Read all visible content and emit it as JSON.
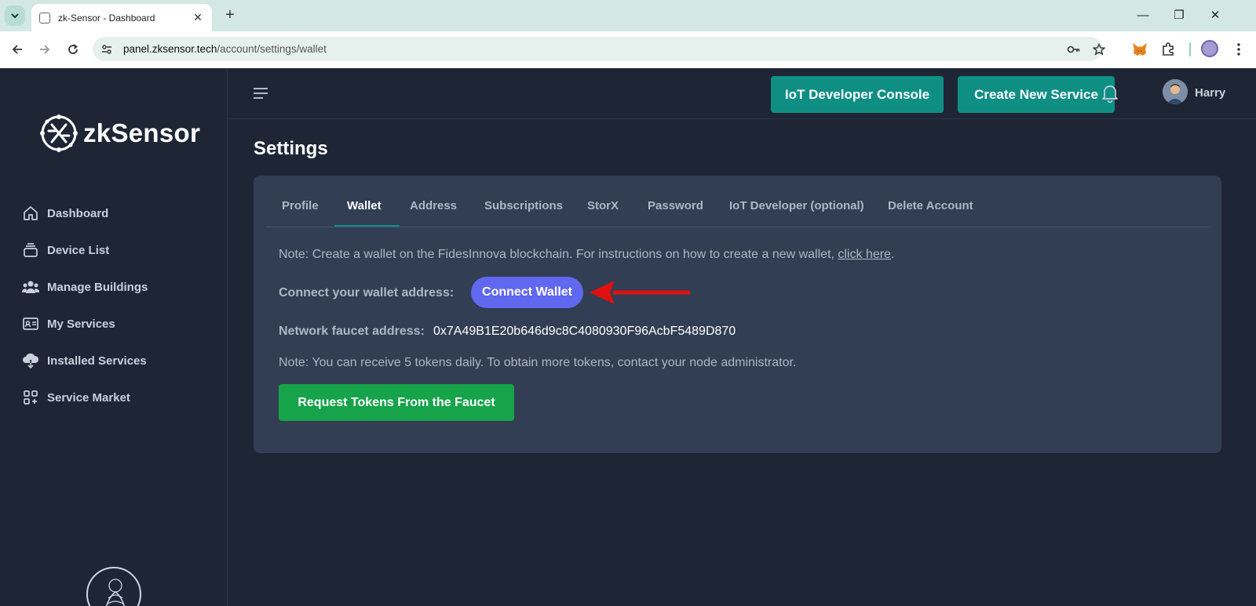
{
  "browser": {
    "tab_title": "zk-Sensor - Dashboard",
    "url_host": "panel.zksensor.tech",
    "url_path": "/account/settings/wallet"
  },
  "sidebar": {
    "logo_text": "zkSensor",
    "items": [
      {
        "label": "Dashboard",
        "icon": "home-icon"
      },
      {
        "label": "Device List",
        "icon": "device-list-icon"
      },
      {
        "label": "Manage Buildings",
        "icon": "users-icon"
      },
      {
        "label": "My Services",
        "icon": "id-card-icon"
      },
      {
        "label": "Installed Services",
        "icon": "cloud-download-icon"
      },
      {
        "label": "Service Market",
        "icon": "grid-plus-icon"
      }
    ]
  },
  "header": {
    "console_button": "IoT Developer Console",
    "create_button": "Create New Service",
    "username": "Harry"
  },
  "main": {
    "title": "Settings",
    "tabs": [
      {
        "label": "Profile"
      },
      {
        "label": "Wallet"
      },
      {
        "label": "Address"
      },
      {
        "label": "Subscriptions"
      },
      {
        "label": "StorX"
      },
      {
        "label": "Password"
      },
      {
        "label": "IoT Developer (optional)"
      },
      {
        "label": "Delete Account"
      }
    ],
    "active_tab": "Wallet",
    "note1_prefix": "Note: Create a wallet on the FidesInnova blockchain. For instructions on how to create a new wallet, ",
    "note1_link": "click here",
    "note1_suffix": ".",
    "connect_label": "Connect your wallet address:",
    "connect_button": "Connect Wallet",
    "faucet_label": "Network faucet address:",
    "faucet_address": "0x7A49B1E20b646d9c8C4080930F96AcbF5489D870",
    "note2": "Note: You can receive 5 tokens daily. To obtain more tokens, contact your node administrator.",
    "request_button": "Request Tokens From the Faucet"
  },
  "colors": {
    "background": "#1e2636",
    "card": "#313e53",
    "teal_button": "#0f8f84",
    "connect_button": "#6168f0",
    "request_button": "#17a34a",
    "arrow": "#e01010"
  }
}
